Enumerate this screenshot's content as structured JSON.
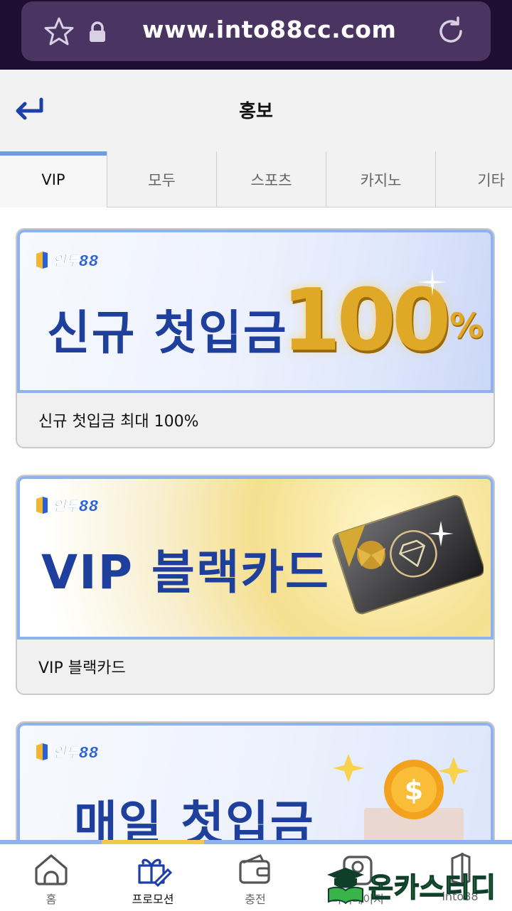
{
  "browser": {
    "url": "www.into88cc.com"
  },
  "header": {
    "title": "홍보"
  },
  "tabs": [
    {
      "label": "VIP"
    },
    {
      "label": "모두"
    },
    {
      "label": "스포츠"
    },
    {
      "label": "카지노"
    },
    {
      "label": "기타"
    }
  ],
  "brand": {
    "logo_text": "인투88"
  },
  "promotions": [
    {
      "headline": "신규 첫입금",
      "highlight": "100",
      "highlight_suffix": "%",
      "caption": "신규 첫입금 최대 100%"
    },
    {
      "headline": "VIP 블랙카드",
      "caption": "VIP 블랙카드"
    },
    {
      "headline": "매일 첫입금"
    }
  ],
  "bottom_nav": [
    {
      "label": "홈",
      "icon": "home-icon"
    },
    {
      "label": "프로모션",
      "icon": "gift-icon"
    },
    {
      "label": "충전",
      "icon": "wallet-icon"
    },
    {
      "label": "마이페이지",
      "icon": "profile-icon"
    },
    {
      "label": "into88",
      "icon": "into88-icon"
    }
  ],
  "watermark": {
    "text": "온카스터디"
  },
  "colors": {
    "accent": "#6f9ce8",
    "active_indicator": "#f2c84b",
    "headline": "#1e3f9c",
    "gold": "#e0a827",
    "url_bar": "#4a3461"
  }
}
